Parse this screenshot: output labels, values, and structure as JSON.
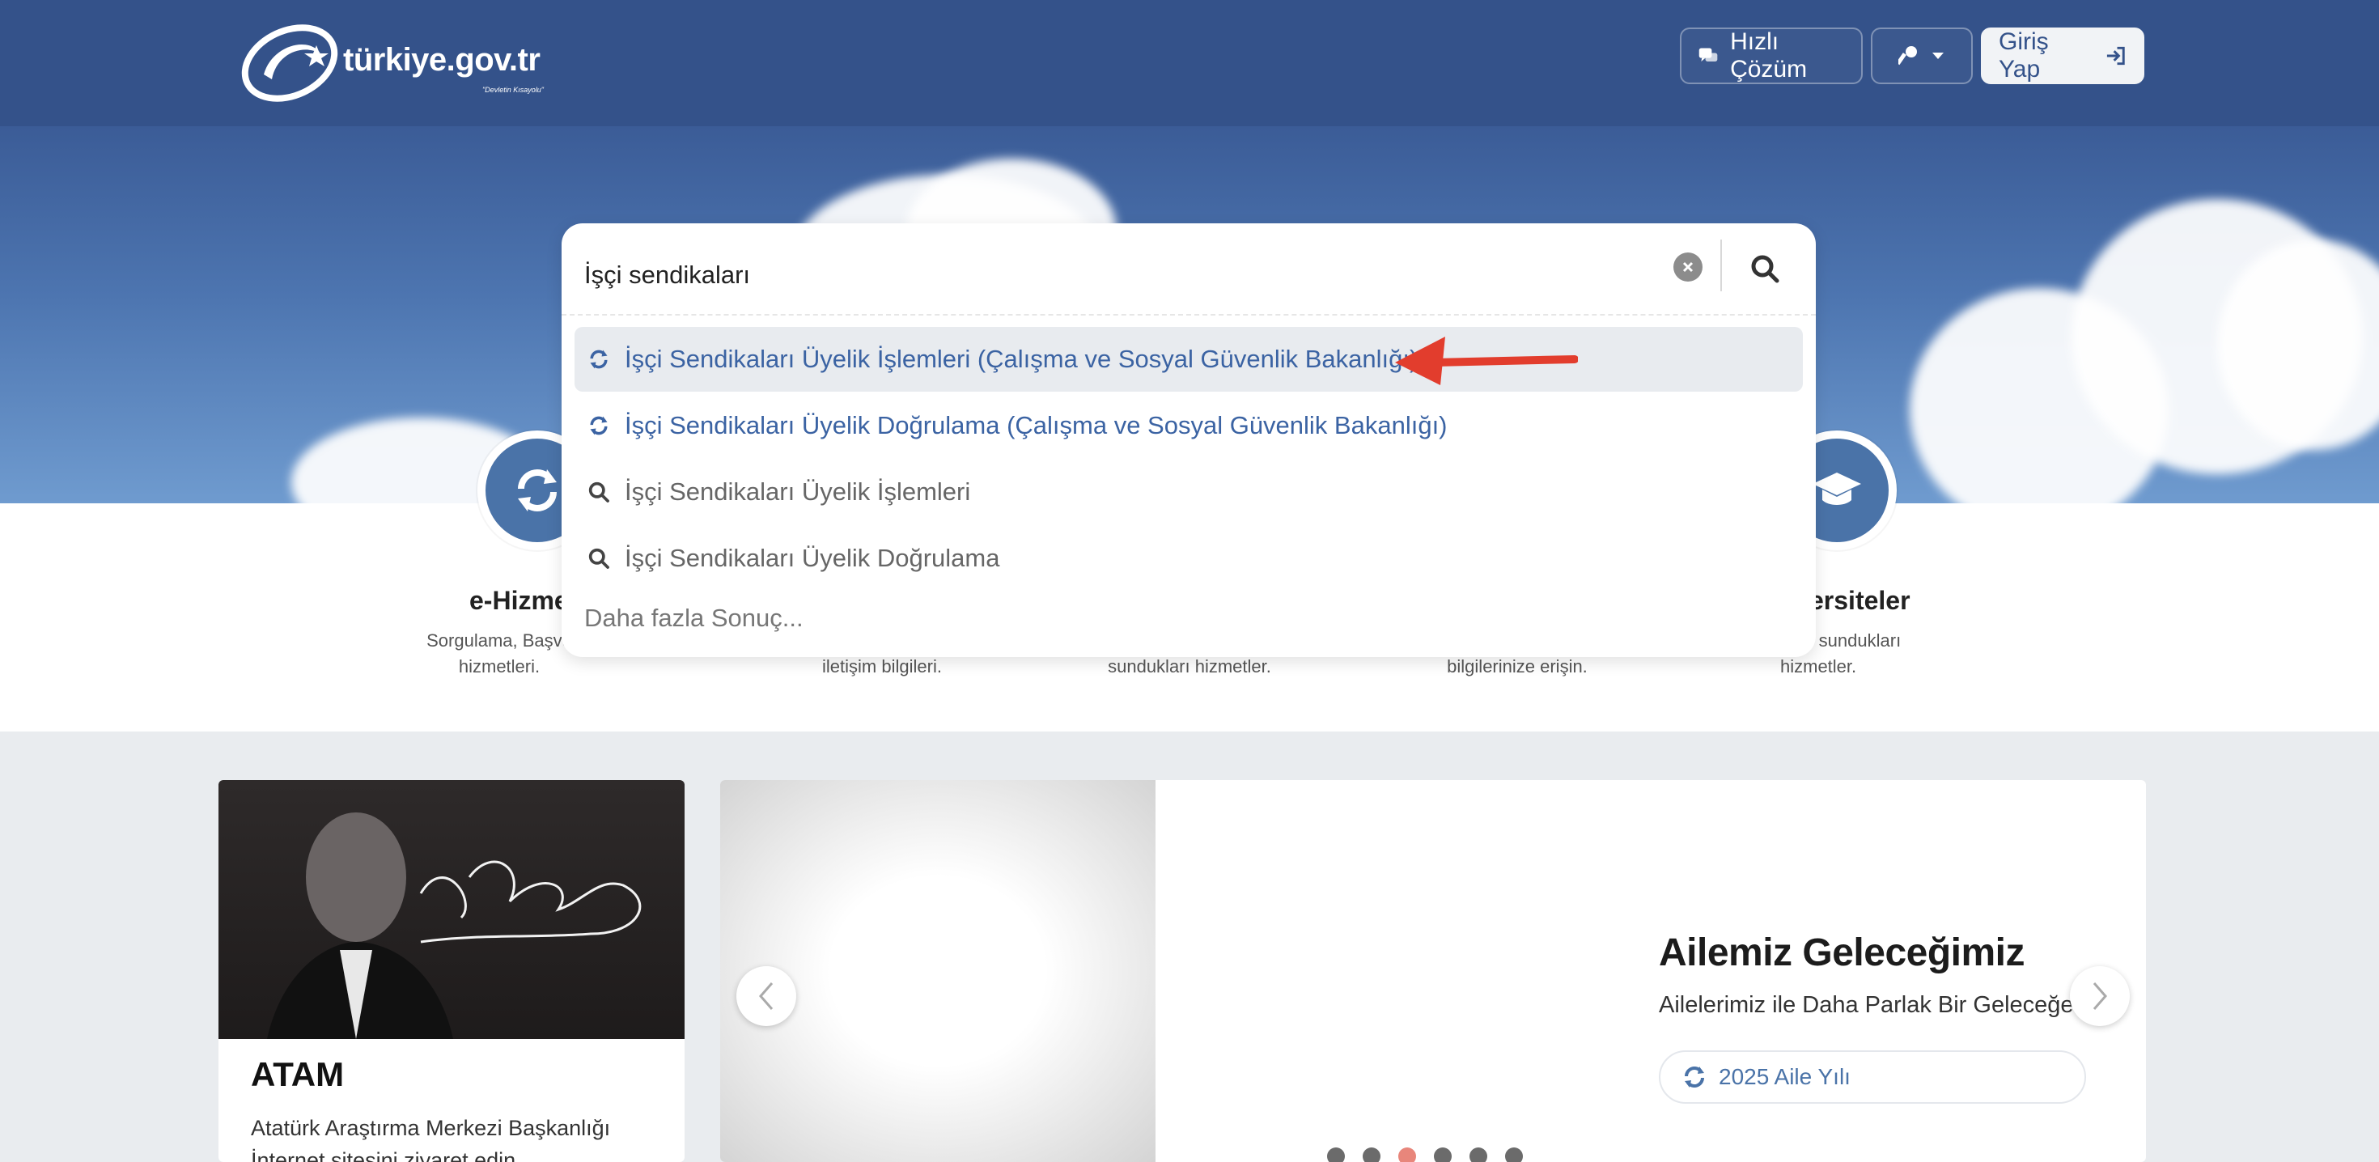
{
  "header": {
    "logo_text": "türkiye.gov.tr",
    "logo_tagline": "\"Devletin Kısayolu\"",
    "quick_solution_label": "Hızlı Çözüm",
    "login_label": "Giriş Yap"
  },
  "search": {
    "value": "İşçi sendikaları",
    "suggestions": [
      {
        "label": "İşçi Sendikaları Üyelik İşlemleri (Çalışma ve Sosyal Güvenlik Bakanlığı)",
        "kind": "service",
        "icon": "refresh-icon"
      },
      {
        "label": "İşçi Sendikaları Üyelik Doğrulama (Çalışma ve Sosyal Güvenlik Bakanlığı)",
        "kind": "service",
        "icon": "refresh-icon"
      },
      {
        "label": "İşçi Sendikaları Üyelik İşlemleri",
        "kind": "query",
        "icon": "search-icon"
      },
      {
        "label": "İşçi Sendikaları Üyelik Doğrulama",
        "kind": "query",
        "icon": "search-icon"
      }
    ],
    "more_results_label": "Daha fazla Sonuç..."
  },
  "services": {
    "left": {
      "title": "e-Hizme",
      "desc_line1": "Sorgulama, Başvu",
      "desc_line2": "hizmetleri."
    },
    "right": {
      "title": "ersiteler",
      "desc_line1": "lerin sundukları",
      "desc_line2": "hizmetler."
    },
    "hidden_desc": [
      "iletişim bilgileri.",
      "sundukları hizmetler.",
      "bilgilerinize erişin."
    ]
  },
  "atam": {
    "title": "ATAM",
    "desc": "Atatürk Araştırma Merkezi Başkanlığı İnternet sitesini ziyaret edin."
  },
  "slider": {
    "title": "Ailemiz Geleceğimiz",
    "subtitle": "Ailelerimiz ile Daha Parlak Bir Geleceğe.",
    "button_label": "2025 Aile Yılı",
    "dot_count": 6,
    "active_dot": 2
  },
  "colors": {
    "brand_blue": "#34528a",
    "link_blue": "#3b63a3",
    "arrow_red": "#e23d2d",
    "active_dot": "#e8867b"
  }
}
